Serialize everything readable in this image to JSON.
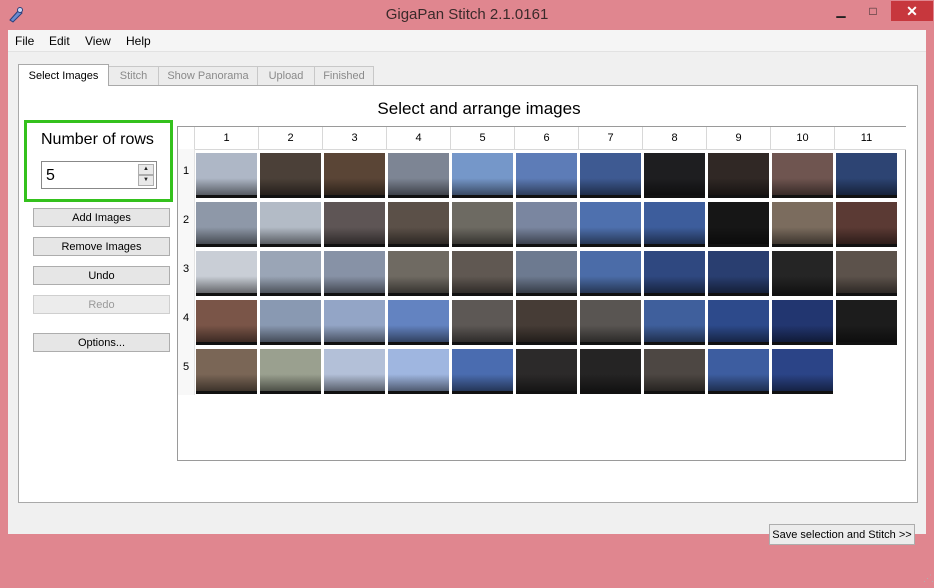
{
  "window": {
    "title": "GigaPan Stitch 2.1.0161",
    "min_glyph": "▁",
    "max_glyph": "□",
    "close_glyph": "✕"
  },
  "menu": [
    "File",
    "Edit",
    "View",
    "Help"
  ],
  "tabs": [
    {
      "label": "Select Images",
      "active": true
    },
    {
      "label": "Stitch",
      "active": false
    },
    {
      "label": "Show Panorama",
      "active": false
    },
    {
      "label": "Upload",
      "active": false
    },
    {
      "label": "Finished",
      "active": false
    }
  ],
  "heading": "Select and arrange images",
  "rows_control": {
    "label": "Number of rows",
    "value": "5",
    "highlight_color": "#34c11d"
  },
  "buttons": {
    "add": "Add Images",
    "remove": "Remove Images",
    "undo": "Undo",
    "redo": "Redo",
    "options": "Options...",
    "stitch": "Save selection and Stitch >>"
  },
  "grid": {
    "columns": [
      "1",
      "2",
      "3",
      "4",
      "5",
      "6",
      "7",
      "8",
      "9",
      "10",
      "11"
    ],
    "rows": [
      "1",
      "2",
      "3",
      "4",
      "5"
    ],
    "images": [
      [
        "#aeb7c6",
        "#4b4038",
        "#5a4536",
        "#7d8594",
        "#7597c9",
        "#5d7cb7",
        "#3e5a92",
        "#1e1e20",
        "#302825",
        "#6f5550",
        "#2d4473"
      ],
      [
        "#8e98a8",
        "#b3bbc6",
        "#5e5555",
        "#5b5048",
        "#6d6a62",
        "#7a86a0",
        "#4e70ae",
        "#3d5d9c",
        "#161616",
        "#7b6c5e",
        "#5b3a34"
      ],
      [
        "#c9ced6",
        "#9aa5b6",
        "#8792a6",
        "#6f6a62",
        "#605852",
        "#6d7a90",
        "#4b6ca8",
        "#2f4880",
        "#293e70",
        "#252525",
        "#5c524b"
      ],
      [
        "#7a5548",
        "#8999b2",
        "#93a5c6",
        "#6383c1",
        "#5d5855",
        "#463c36",
        "#595552",
        "#3f5f9c",
        "#2d4a8b",
        "#223670",
        "#1c1c1c"
      ],
      [
        "#7a6656",
        "#9aa08f",
        "#b3c0d8",
        "#9fb6e0",
        "#4a6cb0",
        "#2c2a2a",
        "#252424",
        "#4d4743",
        "#3d5da0",
        "#2b4487",
        ""
      ]
    ]
  }
}
